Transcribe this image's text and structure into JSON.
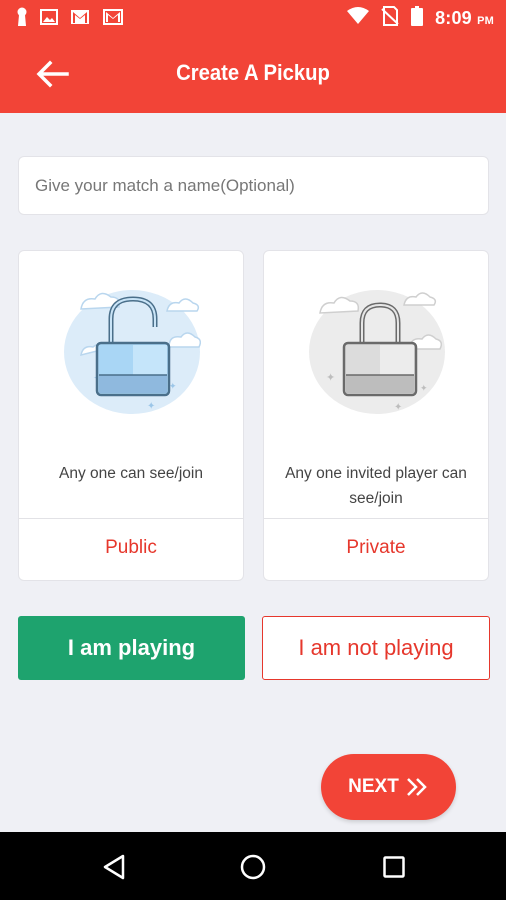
{
  "status_bar": {
    "time": "8:09",
    "ampm": "PM",
    "left_icons": [
      "keyhole-icon",
      "image-icon",
      "gmail-icon",
      "gmail-icon"
    ],
    "right_icons": [
      "wifi-icon",
      "no-signal-icon",
      "battery-icon"
    ]
  },
  "app_bar": {
    "title": "Create A Pickup",
    "back_icon": "arrow-left-icon"
  },
  "name_field": {
    "placeholder": "Give your match a name(Optional)",
    "value": ""
  },
  "cards": [
    {
      "description": "Any one can see/join",
      "label": "Public",
      "icon": "unlocked-padlock-icon"
    },
    {
      "description": "Any one invited player can see/join",
      "label": "Private",
      "icon": "locked-padlock-icon"
    }
  ],
  "buttons": {
    "playing": "I am playing",
    "not_playing": "I am not playing",
    "next": "NEXT",
    "next_icon": "double-chevron-right-icon"
  },
  "nav": {
    "back_icon": "triangle-back-icon",
    "home_icon": "circle-home-icon",
    "recents_icon": "square-recents-icon"
  },
  "colors": {
    "primary": "#f24437",
    "accent_red": "#e6372c",
    "green": "#1ea36e",
    "background": "#eff0f5"
  }
}
